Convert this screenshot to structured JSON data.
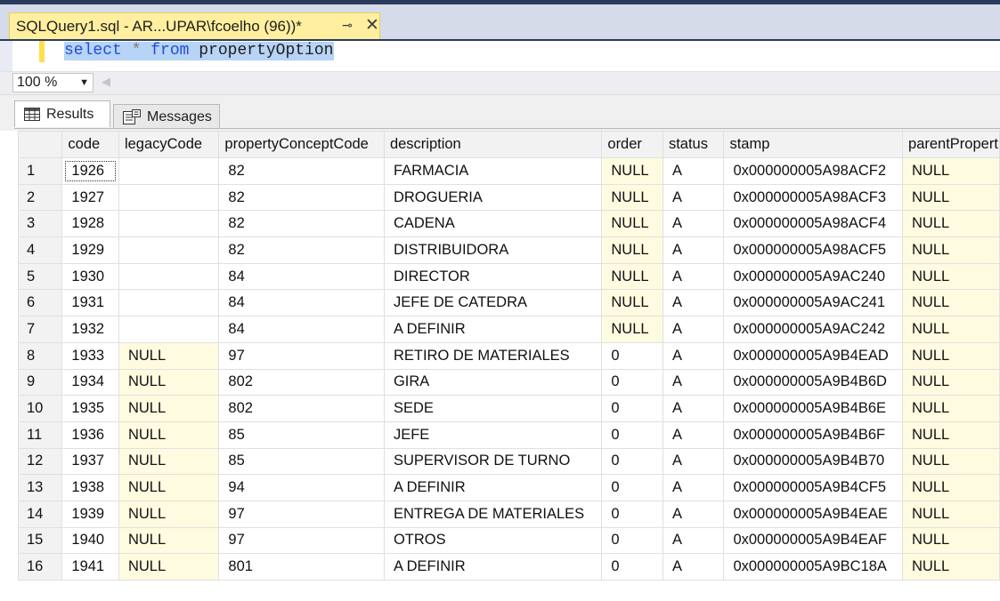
{
  "tab": {
    "title": "SQLQuery1.sql - AR...UPAR\\fcoelho (96))*",
    "pin_glyph": "⊸",
    "close_glyph": "✕"
  },
  "editor": {
    "kw_select": "select",
    "op_star": " * ",
    "kw_from": "from",
    "table": " propertyOption"
  },
  "zoom": {
    "value": "100 %"
  },
  "result_tabs": {
    "results": "Results",
    "messages": "Messages"
  },
  "grid": {
    "columns": [
      "code",
      "legacyCode",
      "propertyConceptCode",
      "description",
      "order",
      "status",
      "stamp",
      "parentPropert"
    ],
    "rows": [
      {
        "n": "1",
        "code": "1926",
        "legacy": "",
        "concept": "82",
        "desc": "FARMACIA",
        "order": "NULL",
        "status": "A",
        "stamp": "0x000000005A98ACF2",
        "parent": "NULL"
      },
      {
        "n": "2",
        "code": "1927",
        "legacy": "",
        "concept": "82",
        "desc": "DROGUERIA",
        "order": "NULL",
        "status": "A",
        "stamp": "0x000000005A98ACF3",
        "parent": "NULL"
      },
      {
        "n": "3",
        "code": "1928",
        "legacy": "",
        "concept": "82",
        "desc": "CADENA",
        "order": "NULL",
        "status": "A",
        "stamp": "0x000000005A98ACF4",
        "parent": "NULL"
      },
      {
        "n": "4",
        "code": "1929",
        "legacy": "",
        "concept": "82",
        "desc": "DISTRIBUIDORA",
        "order": "NULL",
        "status": "A",
        "stamp": "0x000000005A98ACF5",
        "parent": "NULL"
      },
      {
        "n": "5",
        "code": "1930",
        "legacy": "",
        "concept": "84",
        "desc": "DIRECTOR",
        "order": "NULL",
        "status": "A",
        "stamp": "0x000000005A9AC240",
        "parent": "NULL"
      },
      {
        "n": "6",
        "code": "1931",
        "legacy": "",
        "concept": "84",
        "desc": "JEFE DE CATEDRA",
        "order": "NULL",
        "status": "A",
        "stamp": "0x000000005A9AC241",
        "parent": "NULL"
      },
      {
        "n": "7",
        "code": "1932",
        "legacy": "",
        "concept": "84",
        "desc": "A DEFINIR",
        "order": "NULL",
        "status": "A",
        "stamp": "0x000000005A9AC242",
        "parent": "NULL"
      },
      {
        "n": "8",
        "code": "1933",
        "legacy": "NULL",
        "concept": "97",
        "desc": "RETIRO DE MATERIALES",
        "order": "0",
        "status": "A",
        "stamp": "0x000000005A9B4EAD",
        "parent": "NULL"
      },
      {
        "n": "9",
        "code": "1934",
        "legacy": "NULL",
        "concept": "802",
        "desc": "GIRA",
        "order": "0",
        "status": "A",
        "stamp": "0x000000005A9B4B6D",
        "parent": "NULL"
      },
      {
        "n": "10",
        "code": "1935",
        "legacy": "NULL",
        "concept": "802",
        "desc": "SEDE",
        "order": "0",
        "status": "A",
        "stamp": "0x000000005A9B4B6E",
        "parent": "NULL"
      },
      {
        "n": "11",
        "code": "1936",
        "legacy": "NULL",
        "concept": "85",
        "desc": "JEFE",
        "order": "0",
        "status": "A",
        "stamp": "0x000000005A9B4B6F",
        "parent": "NULL"
      },
      {
        "n": "12",
        "code": "1937",
        "legacy": "NULL",
        "concept": "85",
        "desc": "SUPERVISOR DE TURNO",
        "order": "0",
        "status": "A",
        "stamp": "0x000000005A9B4B70",
        "parent": "NULL"
      },
      {
        "n": "13",
        "code": "1938",
        "legacy": "NULL",
        "concept": "94",
        "desc": "A DEFINIR",
        "order": "0",
        "status": "A",
        "stamp": "0x000000005A9B4CF5",
        "parent": "NULL"
      },
      {
        "n": "14",
        "code": "1939",
        "legacy": "NULL",
        "concept": "97",
        "desc": "ENTREGA DE MATERIALES",
        "order": "0",
        "status": "A",
        "stamp": "0x000000005A9B4EAE",
        "parent": "NULL"
      },
      {
        "n": "15",
        "code": "1940",
        "legacy": "NULL",
        "concept": "97",
        "desc": "OTROS",
        "order": "0",
        "status": "A",
        "stamp": "0x000000005A9B4EAF",
        "parent": "NULL"
      },
      {
        "n": "16",
        "code": "1941",
        "legacy": "NULL",
        "concept": "801",
        "desc": "A DEFINIR",
        "order": "0",
        "status": "A",
        "stamp": "0x000000005A9BC18A",
        "parent": "NULL"
      }
    ]
  },
  "colors": {
    "tab_active": "#ffef9e",
    "null_cell": "#fffbe0",
    "keyword": "#1f4fd6",
    "selection": "#b7d3f5",
    "frame": "#2b3a5c"
  }
}
